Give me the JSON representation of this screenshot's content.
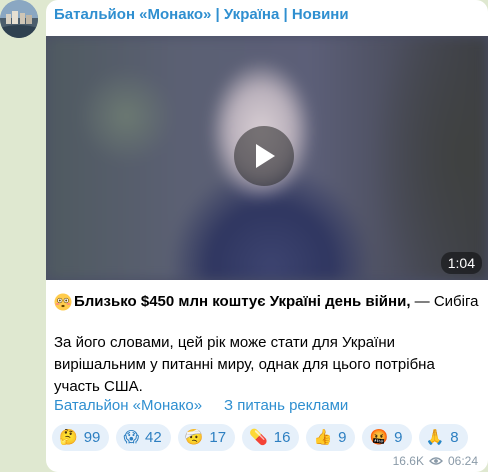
{
  "channel": {
    "title": "Батальйон «Монако» | Україна | Новини"
  },
  "video": {
    "duration": "1:04"
  },
  "post": {
    "headline_bold": "Близько $450 млн коштує Україні день війни,",
    "headline_rest": " — Сибіга",
    "body": "За його словами, цей рік може стати для України вирішальним у питанні миру, однак для цього потрібна участь США."
  },
  "links": {
    "channel_link": "Батальйон «Монако»",
    "ads_link": "З питань реклами"
  },
  "reactions": [
    {
      "emoji": "🤔",
      "count": "99"
    },
    {
      "emoji": "😱",
      "count": "42"
    },
    {
      "emoji": "🤕",
      "count": "17"
    },
    {
      "emoji": "💊",
      "count": "16"
    },
    {
      "emoji": "👍",
      "count": "9"
    },
    {
      "emoji": "🤬",
      "count": "9"
    },
    {
      "emoji": "🙏",
      "count": "8"
    }
  ],
  "meta": {
    "views": "16.6K",
    "time": "06:24"
  },
  "colors": {
    "accent": "#2f8fd0",
    "reaction_bg": "#e6f0fa",
    "chat_bg": "#dfe8d0"
  }
}
